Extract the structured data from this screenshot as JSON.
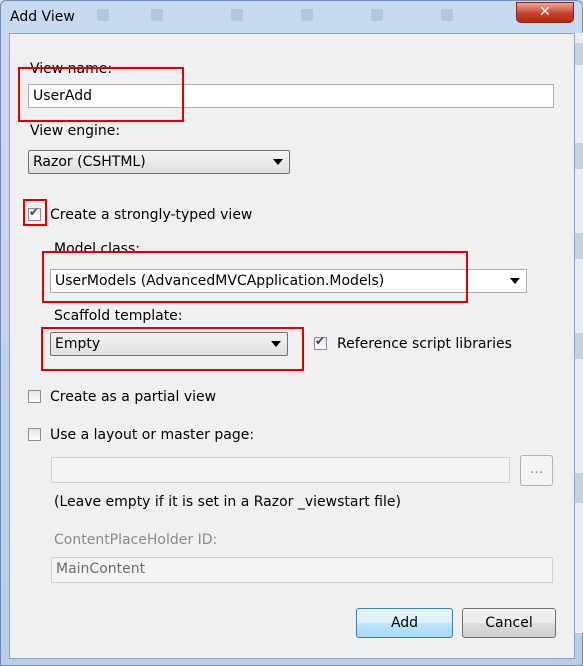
{
  "window": {
    "title": "Add View",
    "close_glyph": "✕"
  },
  "view_name": {
    "label": "View name:",
    "value": "UserAdd"
  },
  "view_engine": {
    "label": "View engine:",
    "selected": "Razor (CSHTML)"
  },
  "strongly_typed": {
    "label": "Create a strongly-typed view",
    "checked": true
  },
  "model_class": {
    "label": "Model class:",
    "selected": "UserModels (AdvancedMVCApplication.Models)"
  },
  "scaffold": {
    "label": "Scaffold template:",
    "selected": "Empty"
  },
  "reference_scripts": {
    "label": "Reference script libraries",
    "checked": true
  },
  "partial_view": {
    "label": "Create as a partial view",
    "checked": false
  },
  "layout_page": {
    "label": "Use a layout or master page:",
    "checked": false,
    "path_value": "",
    "browse_label": "...",
    "hint": "(Leave empty if it is set in a Razor _viewstart file)"
  },
  "content_placeholder": {
    "label": "ContentPlaceHolder ID:",
    "value": "MainContent"
  },
  "buttons": {
    "add": "Add",
    "cancel": "Cancel"
  },
  "colors": {
    "highlight": "#e00000",
    "default_button": "#bee6fd"
  }
}
